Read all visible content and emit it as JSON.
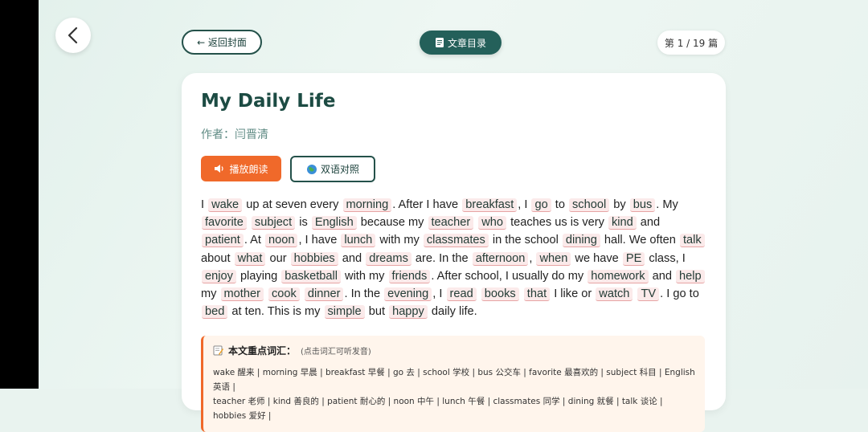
{
  "nav": {
    "back_icon": "chevron-left-icon",
    "back_to_cover_label": "← 返回封面",
    "toc_icon": "document-icon",
    "toc_label": "文章目录",
    "page_indicator": "第 1 / 19 篇"
  },
  "article": {
    "title": "My Daily Life",
    "author": "作者：闫晋清",
    "play_button": {
      "icon": "speaker-icon",
      "label": "播放朗读"
    },
    "bilingual_button": {
      "icon": "globe-icon",
      "label": "双语对照"
    },
    "passage_tokens": [
      {
        "t": "I ",
        "k": false
      },
      {
        "t": "wake",
        "k": true
      },
      {
        "t": " up at seven every ",
        "k": false
      },
      {
        "t": "morning",
        "k": true
      },
      {
        "t": ". After I have ",
        "k": false
      },
      {
        "t": "breakfast",
        "k": true
      },
      {
        "t": ", I ",
        "k": false
      },
      {
        "t": "go",
        "k": true
      },
      {
        "t": " to ",
        "k": false
      },
      {
        "t": "school",
        "k": true
      },
      {
        "t": " by ",
        "k": false
      },
      {
        "t": "bus",
        "k": true
      },
      {
        "t": ". My ",
        "k": false
      },
      {
        "t": "favorite",
        "k": true
      },
      {
        "t": " ",
        "k": false
      },
      {
        "t": "subject",
        "k": true
      },
      {
        "t": " is ",
        "k": false
      },
      {
        "t": "English",
        "k": true
      },
      {
        "t": " because my ",
        "k": false
      },
      {
        "t": "teacher",
        "k": true
      },
      {
        "t": " ",
        "k": false
      },
      {
        "t": "who",
        "k": true
      },
      {
        "t": " teaches us is very ",
        "k": false
      },
      {
        "t": "kind",
        "k": true
      },
      {
        "t": " and ",
        "k": false
      },
      {
        "t": "patient",
        "k": true
      },
      {
        "t": ". At ",
        "k": false
      },
      {
        "t": "noon",
        "k": true
      },
      {
        "t": ", I have ",
        "k": false
      },
      {
        "t": "lunch",
        "k": true
      },
      {
        "t": " with my ",
        "k": false
      },
      {
        "t": "classmates",
        "k": true
      },
      {
        "t": " in the school ",
        "k": false
      },
      {
        "t": "dining",
        "k": true
      },
      {
        "t": " hall. We often ",
        "k": false
      },
      {
        "t": "talk",
        "k": true
      },
      {
        "t": " about ",
        "k": false
      },
      {
        "t": "what",
        "k": true
      },
      {
        "t": " our ",
        "k": false
      },
      {
        "t": "hobbies",
        "k": true
      },
      {
        "t": " and ",
        "k": false
      },
      {
        "t": "dreams",
        "k": true
      },
      {
        "t": " are. In the ",
        "k": false
      },
      {
        "t": "afternoon",
        "k": true
      },
      {
        "t": ", ",
        "k": false
      },
      {
        "t": "when",
        "k": true
      },
      {
        "t": " we have ",
        "k": false
      },
      {
        "t": "PE",
        "k": true
      },
      {
        "t": " class, I ",
        "k": false
      },
      {
        "t": "enjoy",
        "k": true
      },
      {
        "t": " playing ",
        "k": false
      },
      {
        "t": "basketball",
        "k": true
      },
      {
        "t": " with my ",
        "k": false
      },
      {
        "t": "friends",
        "k": true
      },
      {
        "t": ". After school, I usually do my ",
        "k": false
      },
      {
        "t": "homework",
        "k": true
      },
      {
        "t": " and ",
        "k": false
      },
      {
        "t": "help",
        "k": true
      },
      {
        "t": " my ",
        "k": false
      },
      {
        "t": "mother",
        "k": true
      },
      {
        "t": " ",
        "k": false
      },
      {
        "t": "cook",
        "k": true
      },
      {
        "t": " ",
        "k": false
      },
      {
        "t": "dinner",
        "k": true
      },
      {
        "t": ". In the ",
        "k": false
      },
      {
        "t": "evening",
        "k": true
      },
      {
        "t": ", I ",
        "k": false
      },
      {
        "t": "read",
        "k": true
      },
      {
        "t": " ",
        "k": false
      },
      {
        "t": "books",
        "k": true
      },
      {
        "t": " ",
        "k": false
      },
      {
        "t": "that",
        "k": true
      },
      {
        "t": " I like or ",
        "k": false
      },
      {
        "t": "watch",
        "k": true
      },
      {
        "t": " ",
        "k": false
      },
      {
        "t": "TV",
        "k": true
      },
      {
        "t": ". I go to ",
        "k": false
      },
      {
        "t": "bed",
        "k": true
      },
      {
        "t": " at ten. This is my ",
        "k": false
      },
      {
        "t": "simple",
        "k": true
      },
      {
        "t": " but ",
        "k": false
      },
      {
        "t": "happy",
        "k": true
      },
      {
        "t": " daily life.",
        "k": false
      }
    ]
  },
  "vocab": {
    "icon": "memo-icon",
    "heading": "本文重点词汇：",
    "note": "(点击词汇可听发音)",
    "line1": "wake 醒来 | morning 早晨 | breakfast 早餐 | go 去 | school 学校 | bus 公交车 | favorite 最喜欢的 | subject 科目 | English 英语 |",
    "line2": "teacher 老师 | kind 善良的 | patient 耐心的 | noon 中午 | lunch 午餐 | classmates 同学 | dining 就餐 | talk 谈论 | hobbies 爱好 |"
  },
  "colors": {
    "accent_green": "#24605a",
    "accent_orange": "#f0692a",
    "keyword_bg": "#fbeaea"
  }
}
